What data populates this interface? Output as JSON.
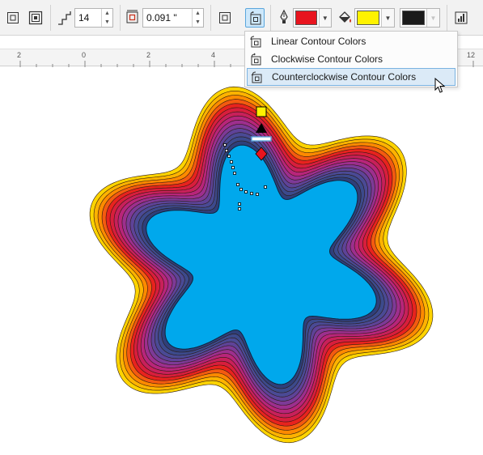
{
  "toolbar": {
    "steps_value": "14",
    "offset_value": "0.091 \"",
    "outline_color": "#e8141e",
    "fill_color": "#fff200",
    "third_color": "#1a1a1a"
  },
  "contour_menu": {
    "items": [
      {
        "label": "Linear Contour Colors",
        "icon": "linear-contour-icon"
      },
      {
        "label": "Clockwise Contour Colors",
        "icon": "clockwise-contour-icon"
      },
      {
        "label": "Counterclockwise Contour Colors",
        "icon": "counterclockwise-contour-icon",
        "highlighted": true
      }
    ]
  },
  "ruler": {
    "labels": [
      "2",
      "0",
      "2",
      "4",
      "12"
    ]
  },
  "colors": {
    "inner_fill": "#00a8ec",
    "outer_contour": "#ffd400",
    "accent": "#5aa6dc"
  }
}
